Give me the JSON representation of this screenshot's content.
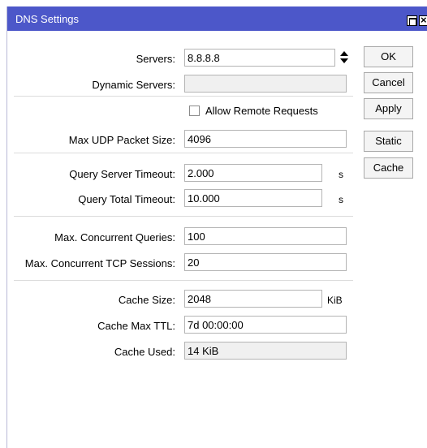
{
  "window": {
    "title": "DNS Settings",
    "buttons": {
      "maximize": "maximize-icon",
      "close": "close-icon"
    }
  },
  "colors": {
    "titlebar": "#4c57c9",
    "field_border": "#b4b4b4",
    "readonly_bg": "#f0f0f0"
  },
  "form": {
    "servers": {
      "label": "Servers:",
      "value": "8.8.8.8"
    },
    "dynamic_servers": {
      "label": "Dynamic Servers:",
      "value": ""
    },
    "allow_remote": {
      "label": "Allow Remote Requests",
      "checked": false
    },
    "max_udp": {
      "label": "Max UDP Packet Size:",
      "value": "4096"
    },
    "query_server_timeout": {
      "label": "Query Server Timeout:",
      "value": "2.000",
      "unit": "s"
    },
    "query_total_timeout": {
      "label": "Query Total Timeout:",
      "value": "10.000",
      "unit": "s"
    },
    "max_concurrent_queries": {
      "label": "Max. Concurrent Queries:",
      "value": "100"
    },
    "max_concurrent_tcp": {
      "label": "Max. Concurrent TCP Sessions:",
      "value": "20"
    },
    "cache_size": {
      "label": "Cache Size:",
      "value": "2048",
      "unit": "KiB"
    },
    "cache_max_ttl": {
      "label": "Cache Max TTL:",
      "value": "7d 00:00:00"
    },
    "cache_used": {
      "label": "Cache Used:",
      "value": "14 KiB"
    }
  },
  "buttons": {
    "ok": "OK",
    "cancel": "Cancel",
    "apply": "Apply",
    "static": "Static",
    "cache": "Cache"
  }
}
